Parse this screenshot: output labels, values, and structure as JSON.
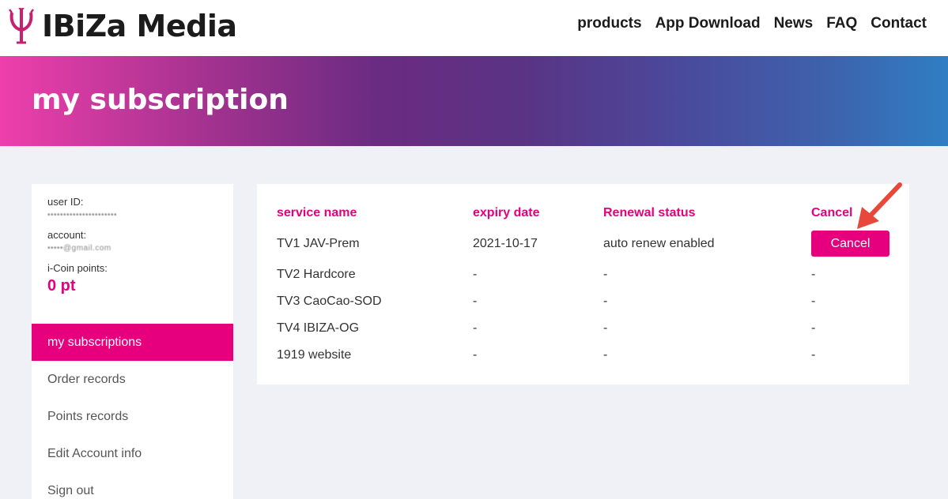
{
  "header": {
    "brand": "IBiZa Media",
    "logo_icon": "trident-icon",
    "nav": [
      "products",
      "App Download",
      "News",
      "FAQ",
      "Contact"
    ]
  },
  "banner": {
    "title": "my subscription"
  },
  "account": {
    "user_id_label": "user ID:",
    "user_id_value": "••••••••••••••••••••••",
    "account_label": "account:",
    "account_value": "•••••@gmail.com",
    "points_label": "i-Coin points:",
    "points_value": "0 pt"
  },
  "menu": {
    "items": [
      "my subscriptions",
      "Order records",
      "Points records",
      "Edit Account info",
      "Sign out"
    ],
    "active": "my subscriptions"
  },
  "table": {
    "headers": [
      "service name",
      "expiry date",
      "Renewal status",
      "Cancel"
    ],
    "rows": [
      [
        "TV1 JAV-Prem",
        "2021-10-17",
        "auto renew enabled",
        "Cancel"
      ],
      [
        "TV2 Hardcore",
        "-",
        "-",
        "-"
      ],
      [
        "TV3 CaoCao-SOD",
        "-",
        "-",
        "-"
      ],
      [
        "TV4 IBIZA-OG",
        "-",
        "-",
        "-"
      ],
      [
        "1919 website",
        "-",
        "-",
        "-"
      ]
    ]
  },
  "colors": {
    "accent": "#e6007e",
    "annotation_arrow": "#e8483a"
  }
}
